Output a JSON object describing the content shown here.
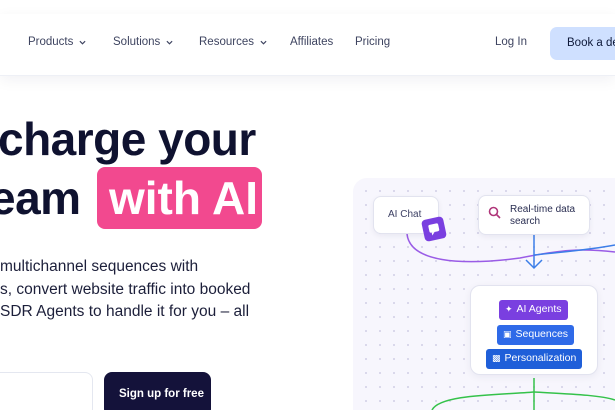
{
  "nav": {
    "items": [
      {
        "label": "Products",
        "dropdown": true
      },
      {
        "label": "Solutions",
        "dropdown": true
      },
      {
        "label": "Resources",
        "dropdown": true
      },
      {
        "label": "Affiliates",
        "dropdown": false
      },
      {
        "label": "Pricing",
        "dropdown": false
      }
    ],
    "login": "Log In",
    "demo": "Book a de"
  },
  "hero": {
    "line1": "charge your",
    "line2": "eam",
    "highlight": "with AI",
    "desc1": "multichannel sequences with",
    "desc2": "s, convert website traffic into booked",
    "desc3": "SDR Agents to handle it for you – all",
    "signup": "Sign up for free"
  },
  "flow": {
    "chat": "AI Chat",
    "search": "Real-time data search",
    "chips": [
      "AI Agents",
      "Sequences",
      "Personalization"
    ]
  },
  "colors": {
    "highlight": "#f2498f",
    "signup_bg": "#14123a",
    "demo_bg": "#cfe0ff",
    "agents": "#7a3fe0",
    "sequences": "#2f6ae8",
    "personalization": "#1f5fd9",
    "line_blue": "#3c7ee8",
    "line_purple": "#9a5ce6",
    "line_green": "#35c24a"
  },
  "icons": {
    "chat_badge": "chat-bubble-icon",
    "search": "search-icon",
    "agents": "sparkle-icon",
    "sequences": "lock-icon",
    "personalization": "id-card-icon"
  }
}
